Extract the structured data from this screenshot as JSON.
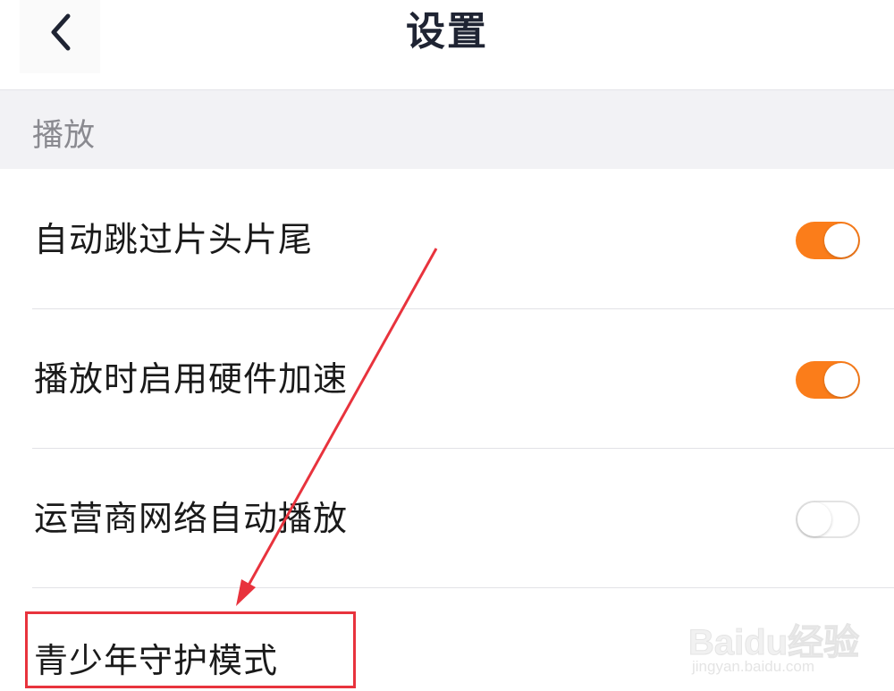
{
  "header": {
    "title": "设置",
    "back_icon": "chevron-left-icon"
  },
  "section": {
    "label": "播放"
  },
  "settings": [
    {
      "label": "自动跳过片头片尾",
      "toggle": "on"
    },
    {
      "label": "播放时启用硬件加速",
      "toggle": "on"
    },
    {
      "label": "运营商网络自动播放",
      "toggle": "off"
    },
    {
      "label": "青少年守护模式"
    }
  ],
  "colors": {
    "accent": "#fb7d1a",
    "annotation": "#e8333d"
  },
  "watermark": {
    "brand": "Baidu经验",
    "url": "jingyan.baidu.com"
  }
}
